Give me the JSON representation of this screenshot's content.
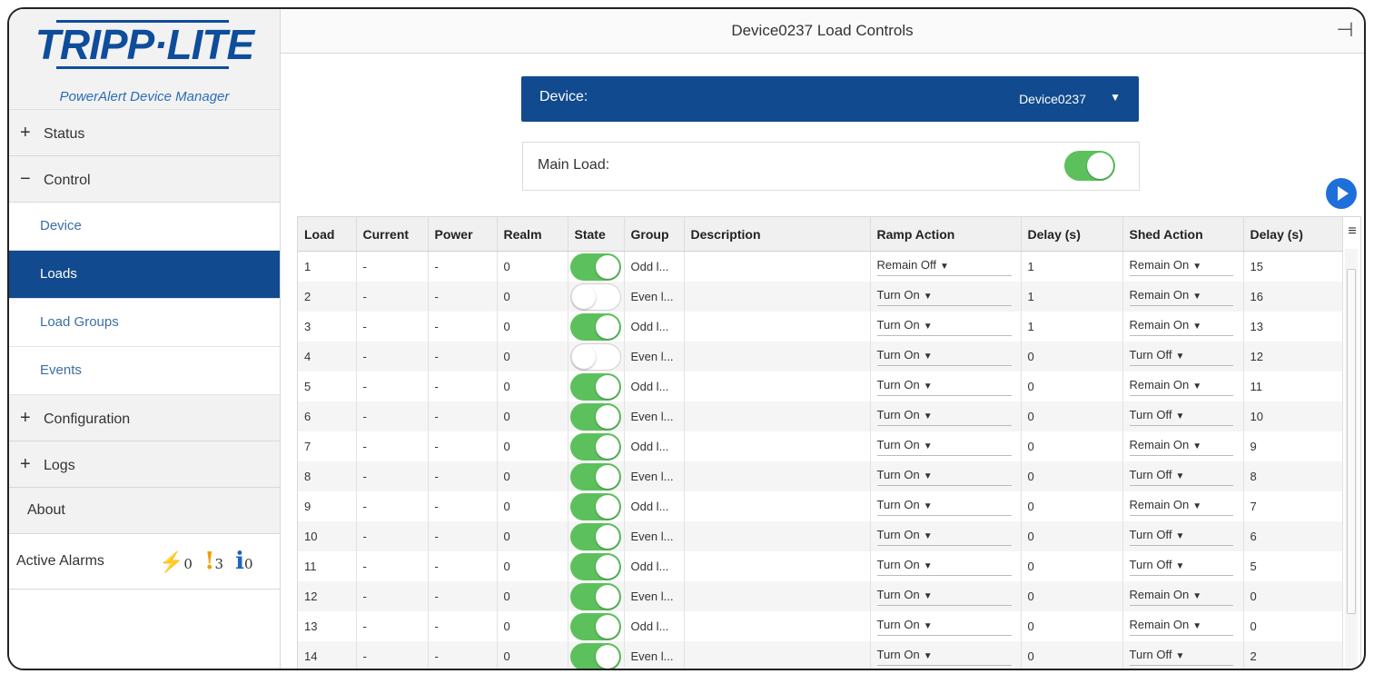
{
  "sidebar": {
    "logo": "TRIPP·LITE",
    "logo_sub": "PowerAlert Device Manager",
    "status": {
      "symbol": "+",
      "label": "Status"
    },
    "control": {
      "symbol": "−",
      "label": "Control"
    },
    "control_items": [
      "Device",
      "Loads",
      "Load Groups",
      "Events"
    ],
    "configuration": {
      "symbol": "+",
      "label": "Configuration"
    },
    "logs": {
      "symbol": "+",
      "label": "Logs"
    },
    "about": "About",
    "alarms": {
      "label": "Active Alarms",
      "critical": "0",
      "warning": "3",
      "info": "0",
      "critical_icon": "⚡",
      "warning_icon": "!",
      "info_icon": "i"
    }
  },
  "header": {
    "title": "Device0237 Load Controls"
  },
  "device": {
    "label": "Device:",
    "value": "Device0237",
    "caret": "▼"
  },
  "main_load": {
    "label": "Main Load:",
    "on": true
  },
  "table": {
    "columns": [
      "Load",
      "Current",
      "Power",
      "Realm",
      "State",
      "Group",
      "Description",
      "Ramp Action",
      "Delay (s)",
      "Shed Action",
      "Delay (s)"
    ],
    "rows": [
      {
        "load": "1",
        "current": "-",
        "power": "-",
        "realm": "0",
        "state": true,
        "group": "Odd l...",
        "description": "",
        "ramp": "Remain Off",
        "ramp_delay": "1",
        "shed": "Remain On",
        "shed_delay": "15"
      },
      {
        "load": "2",
        "current": "-",
        "power": "-",
        "realm": "0",
        "state": false,
        "group": "Even l...",
        "description": "",
        "ramp": "Turn On",
        "ramp_delay": "1",
        "shed": "Remain On",
        "shed_delay": "16"
      },
      {
        "load": "3",
        "current": "-",
        "power": "-",
        "realm": "0",
        "state": true,
        "group": "Odd l...",
        "description": "",
        "ramp": "Turn On",
        "ramp_delay": "1",
        "shed": "Remain On",
        "shed_delay": "13"
      },
      {
        "load": "4",
        "current": "-",
        "power": "-",
        "realm": "0",
        "state": false,
        "group": "Even l...",
        "description": "",
        "ramp": "Turn On",
        "ramp_delay": "0",
        "shed": "Turn Off",
        "shed_delay": "12"
      },
      {
        "load": "5",
        "current": "-",
        "power": "-",
        "realm": "0",
        "state": true,
        "group": "Odd l...",
        "description": "",
        "ramp": "Turn On",
        "ramp_delay": "0",
        "shed": "Remain On",
        "shed_delay": "11"
      },
      {
        "load": "6",
        "current": "-",
        "power": "-",
        "realm": "0",
        "state": true,
        "group": "Even l...",
        "description": "",
        "ramp": "Turn On",
        "ramp_delay": "0",
        "shed": "Turn Off",
        "shed_delay": "10"
      },
      {
        "load": "7",
        "current": "-",
        "power": "-",
        "realm": "0",
        "state": true,
        "group": "Odd l...",
        "description": "",
        "ramp": "Turn On",
        "ramp_delay": "0",
        "shed": "Remain On",
        "shed_delay": "9"
      },
      {
        "load": "8",
        "current": "-",
        "power": "-",
        "realm": "0",
        "state": true,
        "group": "Even l...",
        "description": "",
        "ramp": "Turn On",
        "ramp_delay": "0",
        "shed": "Turn Off",
        "shed_delay": "8"
      },
      {
        "load": "9",
        "current": "-",
        "power": "-",
        "realm": "0",
        "state": true,
        "group": "Odd l...",
        "description": "",
        "ramp": "Turn On",
        "ramp_delay": "0",
        "shed": "Remain On",
        "shed_delay": "7"
      },
      {
        "load": "10",
        "current": "-",
        "power": "-",
        "realm": "0",
        "state": true,
        "group": "Even l...",
        "description": "",
        "ramp": "Turn On",
        "ramp_delay": "0",
        "shed": "Turn Off",
        "shed_delay": "6"
      },
      {
        "load": "11",
        "current": "-",
        "power": "-",
        "realm": "0",
        "state": true,
        "group": "Odd l...",
        "description": "",
        "ramp": "Turn On",
        "ramp_delay": "0",
        "shed": "Turn Off",
        "shed_delay": "5"
      },
      {
        "load": "12",
        "current": "-",
        "power": "-",
        "realm": "0",
        "state": true,
        "group": "Even l...",
        "description": "",
        "ramp": "Turn On",
        "ramp_delay": "0",
        "shed": "Remain On",
        "shed_delay": "0"
      },
      {
        "load": "13",
        "current": "-",
        "power": "-",
        "realm": "0",
        "state": true,
        "group": "Odd l...",
        "description": "",
        "ramp": "Turn On",
        "ramp_delay": "0",
        "shed": "Remain On",
        "shed_delay": "0"
      },
      {
        "load": "14",
        "current": "-",
        "power": "-",
        "realm": "0",
        "state": true,
        "group": "Even l...",
        "description": "",
        "ramp": "Turn On",
        "ramp_delay": "0",
        "shed": "Turn Off",
        "shed_delay": "2"
      }
    ]
  },
  "colors": {
    "brand": "#114a8e",
    "toggle_on": "#5cc15c",
    "play": "#1e6fd9"
  },
  "icons": {
    "logout": "logout-icon",
    "play": "play-icon",
    "menu": "hamburger-menu-icon"
  }
}
